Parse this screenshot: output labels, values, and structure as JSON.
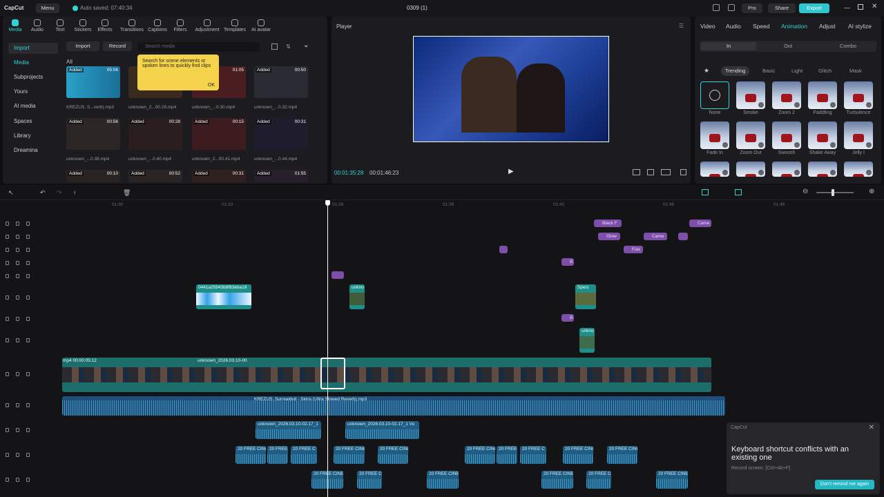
{
  "app": {
    "logo": "CapCut",
    "menu": "Menu",
    "autosave": "Auto saved: 07:40:34",
    "project": "0309 (1)",
    "pro": "Pro",
    "share": "Share",
    "export": "Export"
  },
  "toolbar": [
    "Media",
    "Audio",
    "Text",
    "Stickers",
    "Effects",
    "Transitions",
    "Captions",
    "Filters",
    "Adjustment",
    "Templates",
    "AI avatar"
  ],
  "sidebar": [
    "Import",
    "Media",
    "Subprojects",
    "Yours",
    "AI media",
    "Spaces",
    "Library",
    "Dreamina"
  ],
  "media": {
    "import": "Import",
    "record": "Record",
    "search_placeholder": "Search media",
    "filter": "All",
    "tooltip": "Search for scene elements or spoken lines to quickly find clips",
    "tooltip_ok": "OK",
    "items": [
      {
        "badge": "Added",
        "dur": "05:06",
        "cap": "KREZUS, S...verb).mp3"
      },
      {
        "badge": "",
        "dur": "",
        "cap": "unknown_2...00.29.mp4"
      },
      {
        "badge": "",
        "dur": "01:05",
        "cap": "unknown_...0.30.mp4"
      },
      {
        "badge": "Added",
        "dur": "00:50",
        "cap": "unknown_...0.32.mp4"
      },
      {
        "badge": "Added",
        "dur": "00:56",
        "cap": "unknown_...0.38.mp4"
      },
      {
        "badge": "Added",
        "dur": "00:28",
        "cap": "unknown_...0.40.mp4"
      },
      {
        "badge": "Added",
        "dur": "00:15",
        "cap": "unknown_2...00.41.mp4"
      },
      {
        "badge": "Added",
        "dur": "00:31",
        "cap": "unknown_...0.44.mp4"
      },
      {
        "badge": "Added",
        "dur": "00:10",
        "cap": ""
      },
      {
        "badge": "Added",
        "dur": "00:52",
        "cap": ""
      },
      {
        "badge": "Added",
        "dur": "00:31",
        "cap": ""
      },
      {
        "badge": "Added",
        "dur": "01:55",
        "cap": ""
      }
    ]
  },
  "player": {
    "title": "Player",
    "current": "00:01:35:28",
    "total": "00:01:46:23"
  },
  "right": {
    "tabs": [
      "Video",
      "Audio",
      "Speed",
      "Animation",
      "Adjust",
      "AI stylize"
    ],
    "sub": [
      "In",
      "Out",
      "Combo"
    ],
    "cats": [
      "Trending",
      "Basic",
      "Light",
      "Glitch",
      "Mask"
    ],
    "anims": [
      "None",
      "Smoke",
      "Zoom 2",
      "Paddling",
      "Turbulence",
      "Fade In",
      "Zoom Out",
      "Swoosh",
      "Shake Away",
      "Jelly I",
      "",
      "",
      "",
      "",
      ""
    ]
  },
  "timeline": {
    "ticks": [
      "01:30",
      "01:33",
      "01:36",
      "01:39",
      "01:42",
      "01:45",
      "01:48"
    ],
    "fx": [
      "Black F",
      "Came",
      "Glow",
      "Came",
      "Flas",
      "B",
      "B"
    ],
    "clip_labels": [
      "0441a25943b8f83eba18",
      "unkno",
      "Speci",
      "unkno"
    ],
    "main_label": "mp4  00:00:05:12",
    "main_label2": "unknown_2026.03.10-00",
    "audio_main": "KREZUS, Surrealdvd - Skins (Ultra Slowed  Reverb).mp3",
    "audio2": [
      "unknown_2026.03.10-02.17_1",
      "unknown_2026.03.10-02.17_1  Vo"
    ],
    "sfx": [
      "20 FREE CINE",
      "20 FREE",
      "20 FREE C",
      "20 FREE CINE",
      "20 FREE CINE",
      "20 FREE CINE",
      "20 FREE",
      "20 FREE C",
      "20 FREE CINE",
      "20 FREE CINE"
    ],
    "sfx2": [
      "20 FREE CINEI",
      "20 FREE CI",
      "20 FREE CINEI",
      "20 FREE CINEI",
      "20 FREE CI",
      "20 FREE CINEI"
    ]
  },
  "toast": {
    "app": "CapCut",
    "title": "Keyboard shortcut conflicts with an existing one",
    "detail": "Record screen: [Ctrl+Alt+P]",
    "button": "Don't remind me again"
  }
}
